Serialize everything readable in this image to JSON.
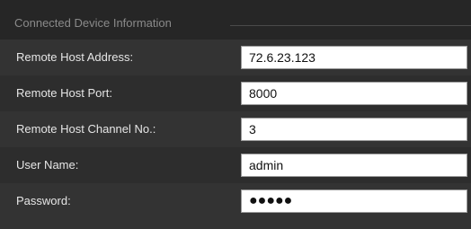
{
  "section": {
    "title": "Connected Device Information"
  },
  "fields": [
    {
      "label": "Remote Host Address:",
      "value": "72.6.23.123"
    },
    {
      "label": "Remote Host Port:",
      "value": "8000"
    },
    {
      "label": "Remote Host Channel No.:",
      "value": "3"
    },
    {
      "label": "User Name:",
      "value": "admin"
    },
    {
      "label": "Password:",
      "value": "●●●●●"
    }
  ]
}
